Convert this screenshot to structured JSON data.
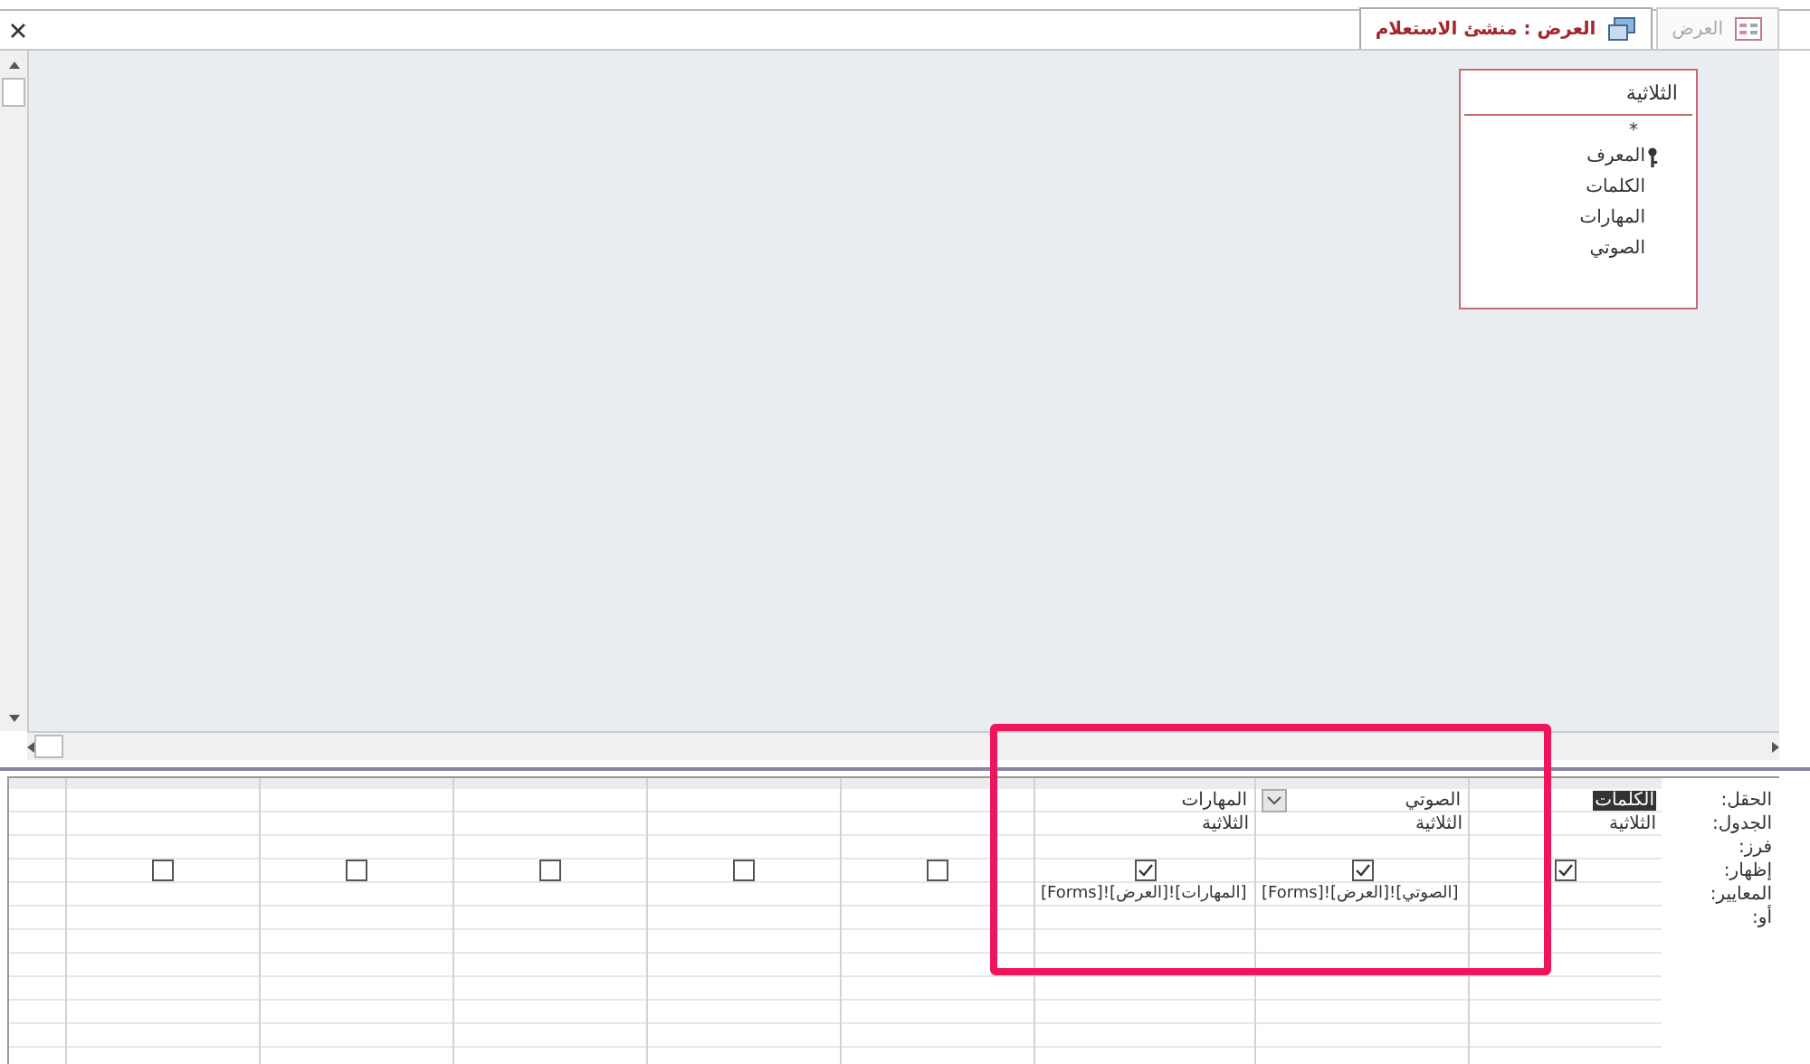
{
  "tabs": [
    {
      "label": "العرض",
      "kind": "form",
      "selected": false
    },
    {
      "label": "العرض : منشئ الاستعلام",
      "kind": "query",
      "selected": true
    }
  ],
  "table_box": {
    "title": "الثلاثية",
    "all_fields": "*",
    "fields": [
      {
        "name": "المعرف",
        "key": true
      },
      {
        "name": "الكلمات",
        "key": false
      },
      {
        "name": "المهارات",
        "key": false
      },
      {
        "name": "الصوتي",
        "key": false
      }
    ]
  },
  "grid": {
    "row_labels": [
      "الحقل:",
      "الجدول:",
      "فرز:",
      "إظهار:",
      "المعايير:",
      "أو:"
    ],
    "columns": [
      {
        "field": "الكلمات",
        "table": "الثلاثية",
        "show": true,
        "field_selected": true,
        "dropdown": false
      },
      {
        "field": "الصوتي",
        "table": "الثلاثية",
        "show": true,
        "criteria": "[Forms]![العرض]![الصوتي]",
        "field_selected": false,
        "dropdown": true
      },
      {
        "field": "المهارات",
        "table": "الثلاثية",
        "show": true,
        "criteria": "[Forms]![العرض]![المهارات]",
        "field_selected": false,
        "dropdown": false
      },
      {
        "show": false
      },
      {
        "show": false
      },
      {
        "show": false
      },
      {
        "show": false
      },
      {
        "show": false
      }
    ]
  },
  "annotation": {
    "kind": "highlight-frame"
  }
}
